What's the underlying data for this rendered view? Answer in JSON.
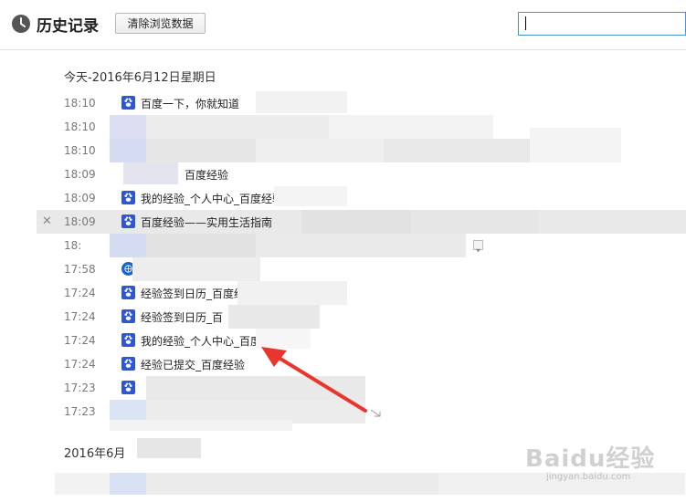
{
  "header": {
    "title": "历史记录",
    "clear_label": "清除浏览数据",
    "search_value": ""
  },
  "sections": [
    {
      "title": "今天-2016年6月12日星期日"
    },
    {
      "title": "2016年6月"
    }
  ],
  "rows": [
    {
      "time": "18:10",
      "label": "百度一下，你就知道",
      "icon": "paw-icon"
    },
    {
      "time": "18:10",
      "label": "",
      "icon": ""
    },
    {
      "time": "18:10",
      "label": "",
      "icon": ""
    },
    {
      "time": "18:09",
      "label": "百度经验",
      "icon": ""
    },
    {
      "time": "18:09",
      "label": "我的经验_个人中心_百度经验",
      "icon": "paw-icon"
    },
    {
      "time": "18:09",
      "label": "百度经验——实用生活指南",
      "icon": "paw-icon"
    },
    {
      "time": "18:",
      "label": "",
      "icon": ""
    },
    {
      "time": "17:58",
      "label": "",
      "icon": "globe-icon"
    },
    {
      "time": "17:24",
      "label": "经验签到日历_百度经",
      "icon": "paw-icon"
    },
    {
      "time": "17:24",
      "label": "经验签到日历_百",
      "icon": "paw-icon"
    },
    {
      "time": "17:24",
      "label": "我的经验_个人中心_百度",
      "icon": "paw-icon"
    },
    {
      "time": "17:24",
      "label": "经验已提交_百度经验",
      "icon": "paw-icon"
    },
    {
      "time": "17:23",
      "label": "",
      "icon": "paw-icon"
    },
    {
      "time": "17:23",
      "label": "",
      "icon": ""
    }
  ],
  "watermark": {
    "brand": "Baidu经验",
    "url": "jingyan.baidu.com"
  },
  "colors": {
    "accent": "#4a90d9",
    "favicon": "#2f56d6",
    "arrow": "#e8352e",
    "hover_row": "#e9e9e9"
  }
}
